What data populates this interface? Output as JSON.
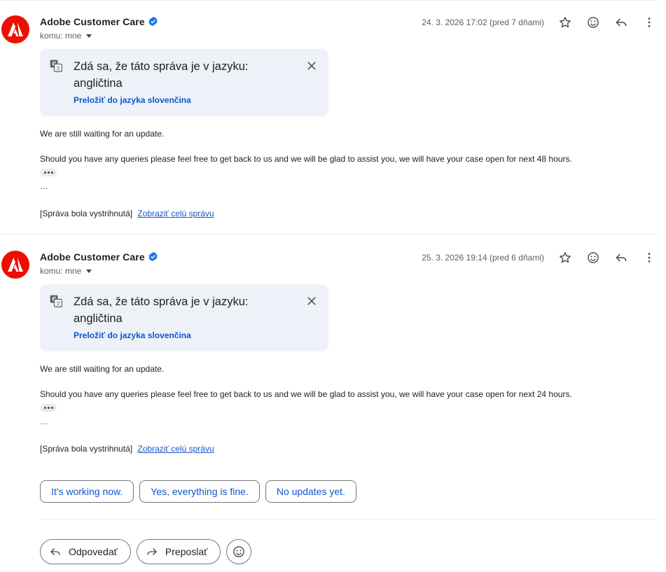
{
  "messages": [
    {
      "sender": "Adobe Customer Care",
      "recipient": "komu: mne",
      "date": "24. 3. 2026 17:02 (pred 7 dňami)",
      "translate_prompt": "Zdá sa, že táto správa je v jazyku: angličtina",
      "translate_link": "Preložiť do jazyka slovenčina",
      "body_line1": "We are still waiting for an update.",
      "body_line2": "Should you have any queries please feel free to get back to us and we will be glad to assist you, we will have your case open for next 48 hours.",
      "ellipsis": "…",
      "clipped_text": "[Správa bola vystrihnutá]",
      "view_full": "Zobraziť celú správu"
    },
    {
      "sender": "Adobe Customer Care",
      "recipient": "komu: mne",
      "date": "25. 3. 2026 19:14 (pred 6 dňami)",
      "translate_prompt": "Zdá sa, že táto správa je v jazyku: angličtina",
      "translate_link": "Preložiť do jazyka slovenčina",
      "body_line1": "We are still waiting for an update.",
      "body_line2": "Should you have any queries please feel free to get back to us and we will be glad to assist you, we will have your case open for next 24 hours.",
      "ellipsis": "…",
      "clipped_text": "[Správa bola vystrihnutá]",
      "view_full": "Zobraziť celú správu"
    }
  ],
  "smart_replies": [
    "It's working now.",
    "Yes, everything is fine.",
    "No updates yet."
  ],
  "actions": {
    "reply": "Odpovedať",
    "forward": "Preposlať"
  },
  "icons": {
    "avatar": "adobe-logo-icon",
    "verified": "verified-badge-icon",
    "star": "star-icon",
    "emoji": "emoji-icon",
    "reply": "reply-icon",
    "more": "more-vert-icon",
    "translate": "translate-icon",
    "close": "close-icon",
    "forward": "forward-icon"
  },
  "colors": {
    "adobe_red": "#eb1000",
    "link_blue": "#0b57d0",
    "card_bg": "#eef2f8",
    "verified_blue": "#1a73e8"
  }
}
